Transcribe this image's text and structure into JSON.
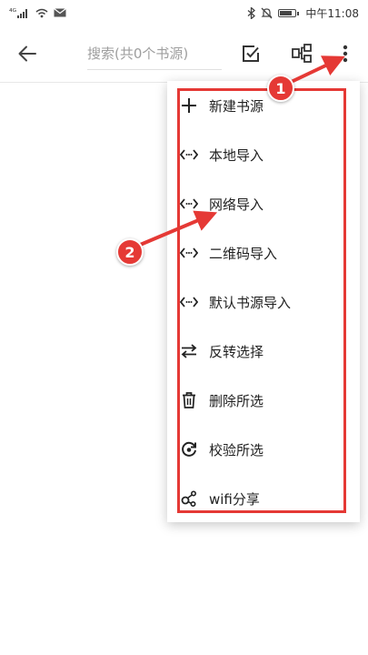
{
  "status_bar": {
    "signal_text": "⁴ᴳ",
    "time_prefix": "中午",
    "time": "11:08",
    "icons": [
      "signal-icon",
      "wifi-icon",
      "mail-icon",
      "bluetooth-icon",
      "mute-icon",
      "battery-icon"
    ],
    "battery_level": 0.85
  },
  "app_bar": {
    "search_placeholder": "搜索(共0个书源)",
    "icons": [
      "back-arrow-icon",
      "edit-check-icon",
      "group-icon",
      "more-vert-icon"
    ]
  },
  "menu": {
    "items": [
      {
        "label": "新建书源",
        "icon": "plus-icon"
      },
      {
        "label": "本地导入",
        "icon": "code-icon"
      },
      {
        "label": "网络导入",
        "icon": "code-icon"
      },
      {
        "label": "二维码导入",
        "icon": "code-icon"
      },
      {
        "label": "默认书源导入",
        "icon": "code-icon"
      },
      {
        "label": "反转选择",
        "icon": "swap-icon"
      },
      {
        "label": "删除所选",
        "icon": "trash-icon"
      },
      {
        "label": "校验所选",
        "icon": "check-refresh-icon"
      },
      {
        "label": "wifi分享",
        "icon": "share-icon"
      }
    ]
  },
  "annotations": {
    "badge_1": "1",
    "badge_2": "2",
    "color": "#e53935"
  }
}
